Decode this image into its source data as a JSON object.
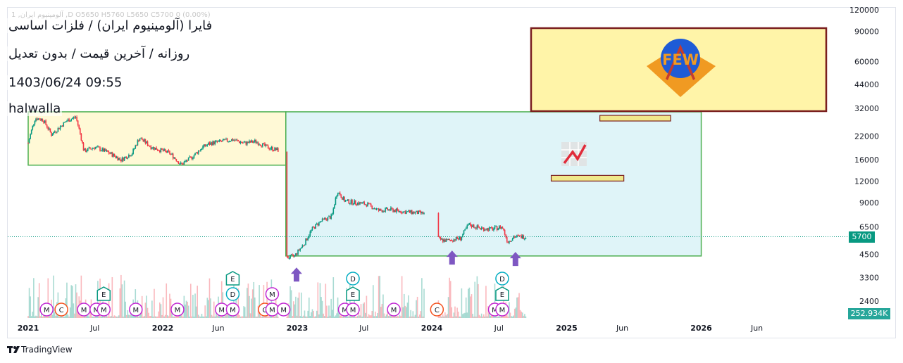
{
  "header": {
    "ohlc_line": "1 ,آلومینیوم ایران ,D  O5650  H5760  L5650  C5700  0 (0.00%)",
    "title": "فایرا (آلومینیوم ایران) / فلزات اساسی",
    "subtitle": "روزانه / آخرین قیمت / بدون تعدیل",
    "timestamp": "1403/06/24 09:55",
    "author": "halwalla"
  },
  "price_tag": {
    "value": "5700",
    "color": "#089981"
  },
  "volume_tag": {
    "value": "252.934K",
    "color": "#26a69a"
  },
  "brand": {
    "name": "TradingView"
  },
  "logo": {
    "text": "FEW",
    "badge_color": "#1e5bd6",
    "chevron_color": "#f09a22"
  },
  "colors": {
    "up": "#089981",
    "down": "#f23645",
    "box_yellow_fill": "#fff9d6",
    "box_cyan_fill": "#dff4f8",
    "box_green_border": "#4caf50",
    "logo_box_fill": "#fff4a8",
    "logo_box_border": "#7a1f1f",
    "arrow": "#7e57c2"
  },
  "chart_data": {
    "type": "candlestick",
    "y_scale": "log",
    "ylim": [
      2000,
      120000
    ],
    "y_ticks": [
      "120000",
      "90000",
      "60000",
      "44000",
      "32000",
      "22000",
      "16000",
      "12000",
      "9000",
      "6500",
      "4500",
      "3300",
      "2400"
    ],
    "y_tick_values": [
      120000,
      90000,
      60000,
      44000,
      32000,
      22000,
      16000,
      12000,
      9000,
      6500,
      4500,
      3300,
      2400
    ],
    "x_ticks": [
      "2021",
      "Jul",
      "2022",
      "Jun",
      "2023",
      "Jul",
      "2024",
      "Jul",
      "2025",
      "Jun",
      "2026",
      "Jun"
    ],
    "x_tick_dates": [
      "2021-01-01",
      "2021-07-01",
      "2022-01-01",
      "2022-06-01",
      "2023-01-01",
      "2023-07-01",
      "2024-01-01",
      "2024-07-01",
      "2025-01-01",
      "2025-06-01",
      "2026-01-01",
      "2026-06-01"
    ],
    "last_price": 5700,
    "price_path": [
      [
        "2021-01-01",
        20000
      ],
      [
        "2021-01-20",
        28000
      ],
      [
        "2021-02-10",
        27500
      ],
      [
        "2021-03-05",
        22500
      ],
      [
        "2021-03-25",
        24500
      ],
      [
        "2021-04-15",
        27000
      ],
      [
        "2021-05-10",
        28500
      ],
      [
        "2021-06-01",
        18000
      ],
      [
        "2021-07-01",
        19000
      ],
      [
        "2021-08-10",
        17500
      ],
      [
        "2021-09-10",
        16000
      ],
      [
        "2021-10-10",
        17500
      ],
      [
        "2021-10-30",
        21500
      ],
      [
        "2021-12-01",
        19000
      ],
      [
        "2022-01-20",
        17500
      ],
      [
        "2022-02-20",
        15000
      ],
      [
        "2022-03-20",
        16500
      ],
      [
        "2022-04-20",
        19000
      ],
      [
        "2022-05-10",
        20000
      ],
      [
        "2022-06-10",
        20500
      ],
      [
        "2022-07-10",
        21000
      ],
      [
        "2022-08-10",
        20000
      ],
      [
        "2022-09-10",
        20500
      ],
      [
        "2022-10-10",
        19000
      ],
      [
        "2022-11-10",
        18200
      ],
      [
        "2022-12-05",
        4300
      ],
      [
        "2022-12-25",
        4400
      ],
      [
        "2023-01-20",
        5200
      ],
      [
        "2023-02-10",
        6300
      ],
      [
        "2023-03-05",
        7000
      ],
      [
        "2023-04-05",
        7500
      ],
      [
        "2023-04-20",
        10500
      ],
      [
        "2023-05-10",
        9200
      ],
      [
        "2023-06-10",
        9000
      ],
      [
        "2023-07-10",
        8800
      ],
      [
        "2023-08-10",
        8100
      ],
      [
        "2023-09-10",
        8200
      ],
      [
        "2023-10-10",
        8000
      ],
      [
        "2023-11-10",
        7900
      ],
      [
        "2023-12-10",
        7800
      ],
      [
        "2024-01-20",
        5500
      ],
      [
        "2024-02-10",
        5400
      ],
      [
        "2024-03-20",
        5600
      ],
      [
        "2024-04-10",
        6700
      ],
      [
        "2024-05-10",
        6400
      ],
      [
        "2024-06-10",
        6300
      ],
      [
        "2024-07-10",
        6500
      ],
      [
        "2024-07-25",
        5300
      ],
      [
        "2024-08-10",
        5700
      ],
      [
        "2024-09-14",
        5700
      ]
    ],
    "markers": [
      {
        "date": "2021-02-20",
        "stack": [
          "M"
        ]
      },
      {
        "date": "2021-04-01",
        "stack": [
          "C"
        ]
      },
      {
        "date": "2021-06-01",
        "stack": [
          "M"
        ]
      },
      {
        "date": "2021-07-05",
        "stack": [
          "M"
        ]
      },
      {
        "date": "2021-07-25",
        "stack": [
          "E",
          "M"
        ]
      },
      {
        "date": "2021-10-20",
        "stack": [
          "M"
        ]
      },
      {
        "date": "2022-02-10",
        "stack": [
          "M"
        ]
      },
      {
        "date": "2022-06-10",
        "stack": [
          "M"
        ]
      },
      {
        "date": "2022-07-10",
        "stack": [
          "E",
          "D",
          "M"
        ]
      },
      {
        "date": "2022-10-05",
        "stack": [
          "C"
        ]
      },
      {
        "date": "2022-10-25",
        "stack": [
          "M",
          "M"
        ]
      },
      {
        "date": "2022-11-25",
        "stack": [
          "M"
        ]
      },
      {
        "date": "2023-05-10",
        "stack": [
          "M"
        ]
      },
      {
        "date": "2023-06-01",
        "stack": [
          "D",
          "E",
          "M"
        ]
      },
      {
        "date": "2023-09-20",
        "stack": [
          "M"
        ]
      },
      {
        "date": "2024-01-15",
        "stack": [
          "C"
        ]
      },
      {
        "date": "2024-06-20",
        "stack": [
          "M"
        ]
      },
      {
        "date": "2024-07-10",
        "stack": [
          "D",
          "E",
          "M"
        ]
      }
    ],
    "arrows": [
      {
        "date": "2022-12-30",
        "price": 4300
      },
      {
        "date": "2024-02-25",
        "price": 5400
      },
      {
        "date": "2024-08-15",
        "price": 5300
      }
    ],
    "rectangles": [
      {
        "from": "2021-01-01",
        "to": "2022-12-01",
        "high": 30500,
        "low": 14900,
        "fill": "yellow"
      },
      {
        "from": "2022-12-01",
        "to": "2026-01-01",
        "high": 30500,
        "low": 4400,
        "fill": "cyan"
      }
    ],
    "small_bars": [
      {
        "from": "2024-11-20",
        "to": "2025-06-05",
        "price": 12500
      },
      {
        "from": "2025-04-01",
        "to": "2025-10-10",
        "price": 28000
      }
    ]
  }
}
